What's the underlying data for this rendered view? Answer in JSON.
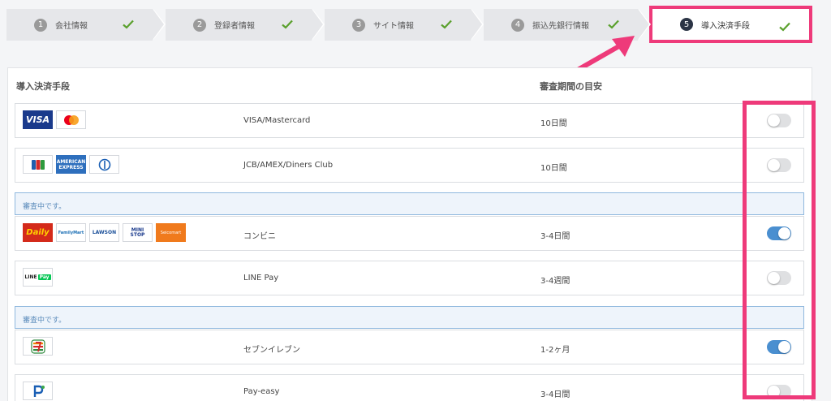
{
  "stepper": {
    "steps": [
      {
        "num": "1",
        "label": "会社情報",
        "done": true
      },
      {
        "num": "2",
        "label": "登録者情報",
        "done": true
      },
      {
        "num": "3",
        "label": "サイト情報",
        "done": true
      },
      {
        "num": "4",
        "label": "振込先銀行情報",
        "done": true
      },
      {
        "num": "5",
        "label": "導入決済手段",
        "done": true,
        "active": true
      }
    ]
  },
  "table": {
    "col_method": "導入決済手段",
    "col_period": "審査期間の目安",
    "notice_text": "審査中です。",
    "rows": [
      {
        "name": "VISA/Mastercard",
        "period": "10日間",
        "enabled": false,
        "logos": [
          "VISA",
          "mastercard-icon"
        ]
      },
      {
        "name": "JCB/AMEX/Diners Club",
        "period": "10日間",
        "enabled": false,
        "logos": [
          "jcb-icon",
          "AMERICAN EXPRESS",
          "diners-icon"
        ]
      },
      {
        "name": "コンビニ",
        "period": "3-4日間",
        "enabled": true,
        "logos": [
          "Daily",
          "FamilyMart",
          "LAWSON",
          "MINI STOP",
          "Seicomart"
        ]
      },
      {
        "name": "LINE Pay",
        "period": "3-4週間",
        "enabled": false,
        "logos": [
          "LINE",
          "Pay"
        ]
      },
      {
        "name": "セブンイレブン",
        "period": "1-2ヶ月",
        "enabled": true,
        "logos": [
          "7-eleven-icon"
        ]
      },
      {
        "name": "Pay-easy",
        "period": "3-4日間",
        "enabled": false,
        "logos": [
          "payeasy-icon"
        ]
      }
    ]
  },
  "colors": {
    "highlight": "#ee3a7a",
    "toggle_on": "#4a8fd0",
    "check": "#5aa02c"
  },
  "logo_text": {
    "visa": "VISA",
    "amex_1": "AMERICAN",
    "amex_2": "EXPRESS",
    "daily": "Daily",
    "family": "FamilyMart",
    "lawson": "LAWSON",
    "mini_1": "MINI",
    "mini_2": "STOP",
    "seicomart": "Seicomart",
    "line": "LINE",
    "pay": "Pay"
  }
}
